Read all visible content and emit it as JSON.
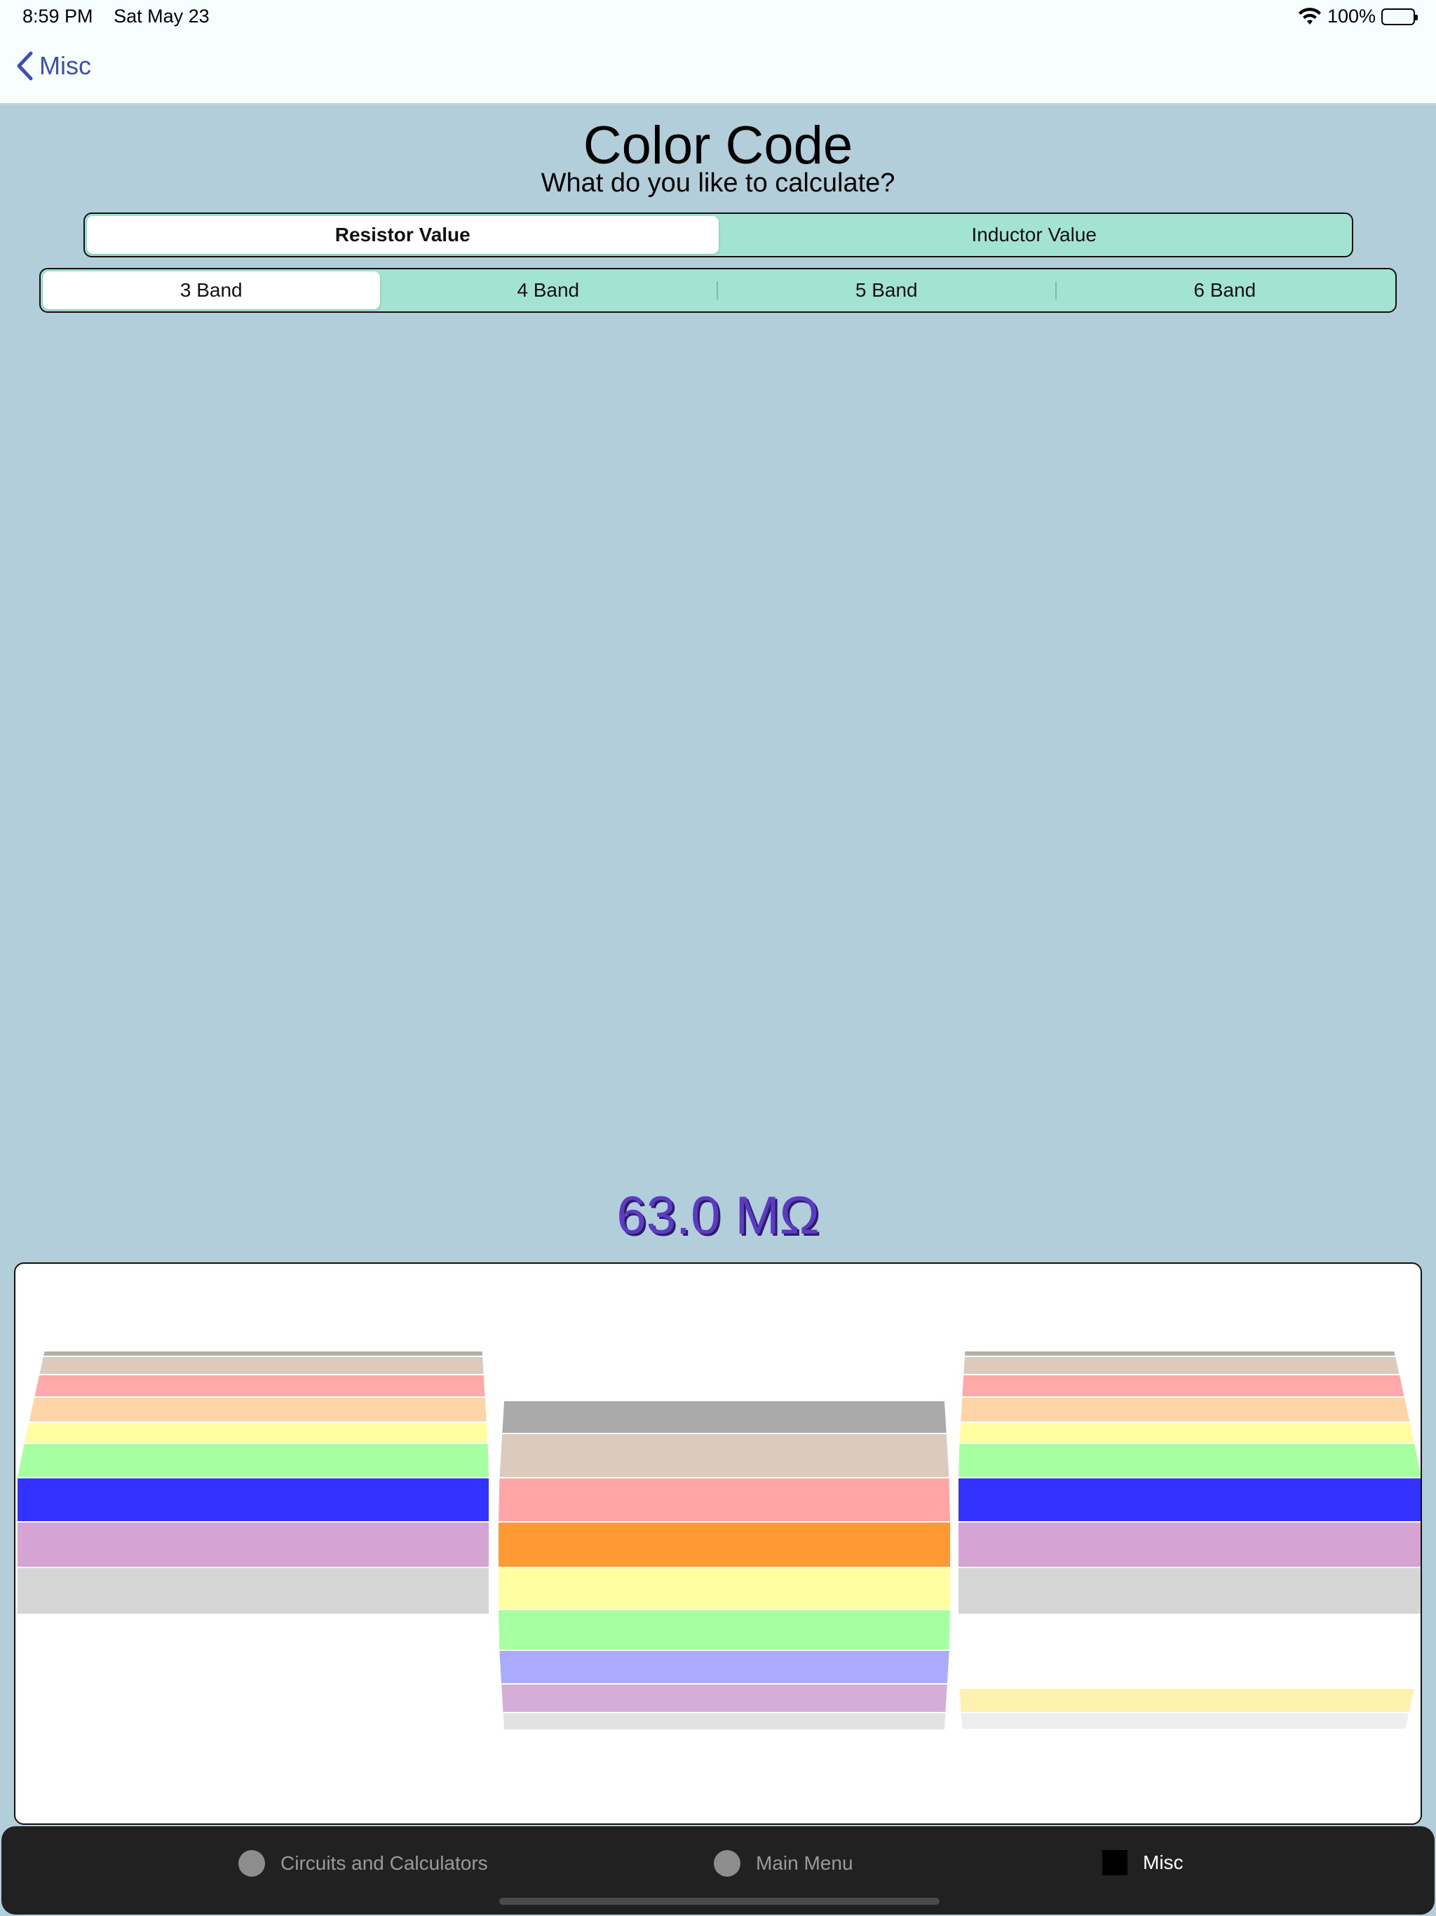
{
  "status_bar": {
    "time": "8:59 PM",
    "date": "Sat May 23",
    "battery": "100%"
  },
  "nav": {
    "back_label": "Misc"
  },
  "title": "Color Code",
  "subtitle": "What do you like to calculate?",
  "type_segments": {
    "options": [
      "Resistor Value",
      "Inductor Value"
    ],
    "selected": "Resistor Value"
  },
  "band_segments": {
    "options": [
      "3 Band",
      "4 Band",
      "5 Band",
      "6 Band"
    ],
    "selected": "3 Band"
  },
  "result": "63.0 MΩ",
  "picker": {
    "selected": [
      "blue",
      "orange",
      "blue"
    ],
    "columns": [
      {
        "name": "first-digit",
        "rows": [
          {
            "color": "#b6b0aa"
          },
          {
            "color": "#dccbbd"
          },
          {
            "color": "#ffaaaa"
          },
          {
            "color": "#ffd5a8"
          },
          {
            "color": "#fefea0"
          },
          {
            "color": "#a6ffa0"
          },
          {
            "color": "#3333ff"
          },
          {
            "color": "#d5a4d5"
          },
          {
            "color": "#d5d5d5"
          }
        ]
      },
      {
        "name": "second-digit",
        "rows": [
          {
            "color": "#aaaaaa"
          },
          {
            "color": "#dccbbd"
          },
          {
            "color": "#ffa5a5"
          },
          {
            "color": "#ff9933"
          },
          {
            "color": "#fefea0"
          },
          {
            "color": "#a6ffa0"
          },
          {
            "color": "#aaaaff"
          },
          {
            "color": "#d5aed8"
          },
          {
            "color": "#e2e2e2"
          }
        ]
      },
      {
        "name": "multiplier",
        "rows": [
          {
            "color": "#b6b0aa"
          },
          {
            "color": "#dccbbd"
          },
          {
            "color": "#ffaaaa"
          },
          {
            "color": "#ffd5a8"
          },
          {
            "color": "#fefea0"
          },
          {
            "color": "#a6ffa0"
          },
          {
            "color": "#3333ff"
          },
          {
            "color": "#d5a4d5"
          },
          {
            "color": "#d5d5d5"
          },
          {
            "color": "#fef1b0"
          },
          {
            "color": "#eeeeee"
          }
        ]
      }
    ]
  },
  "tab_bar": {
    "items": [
      {
        "label": "Circuits and Calculators",
        "icon": "circle-icon",
        "active": false
      },
      {
        "label": "Main Menu",
        "icon": "circle-icon",
        "active": false
      },
      {
        "label": "Misc",
        "icon": "square-icon",
        "active": true
      }
    ]
  }
}
